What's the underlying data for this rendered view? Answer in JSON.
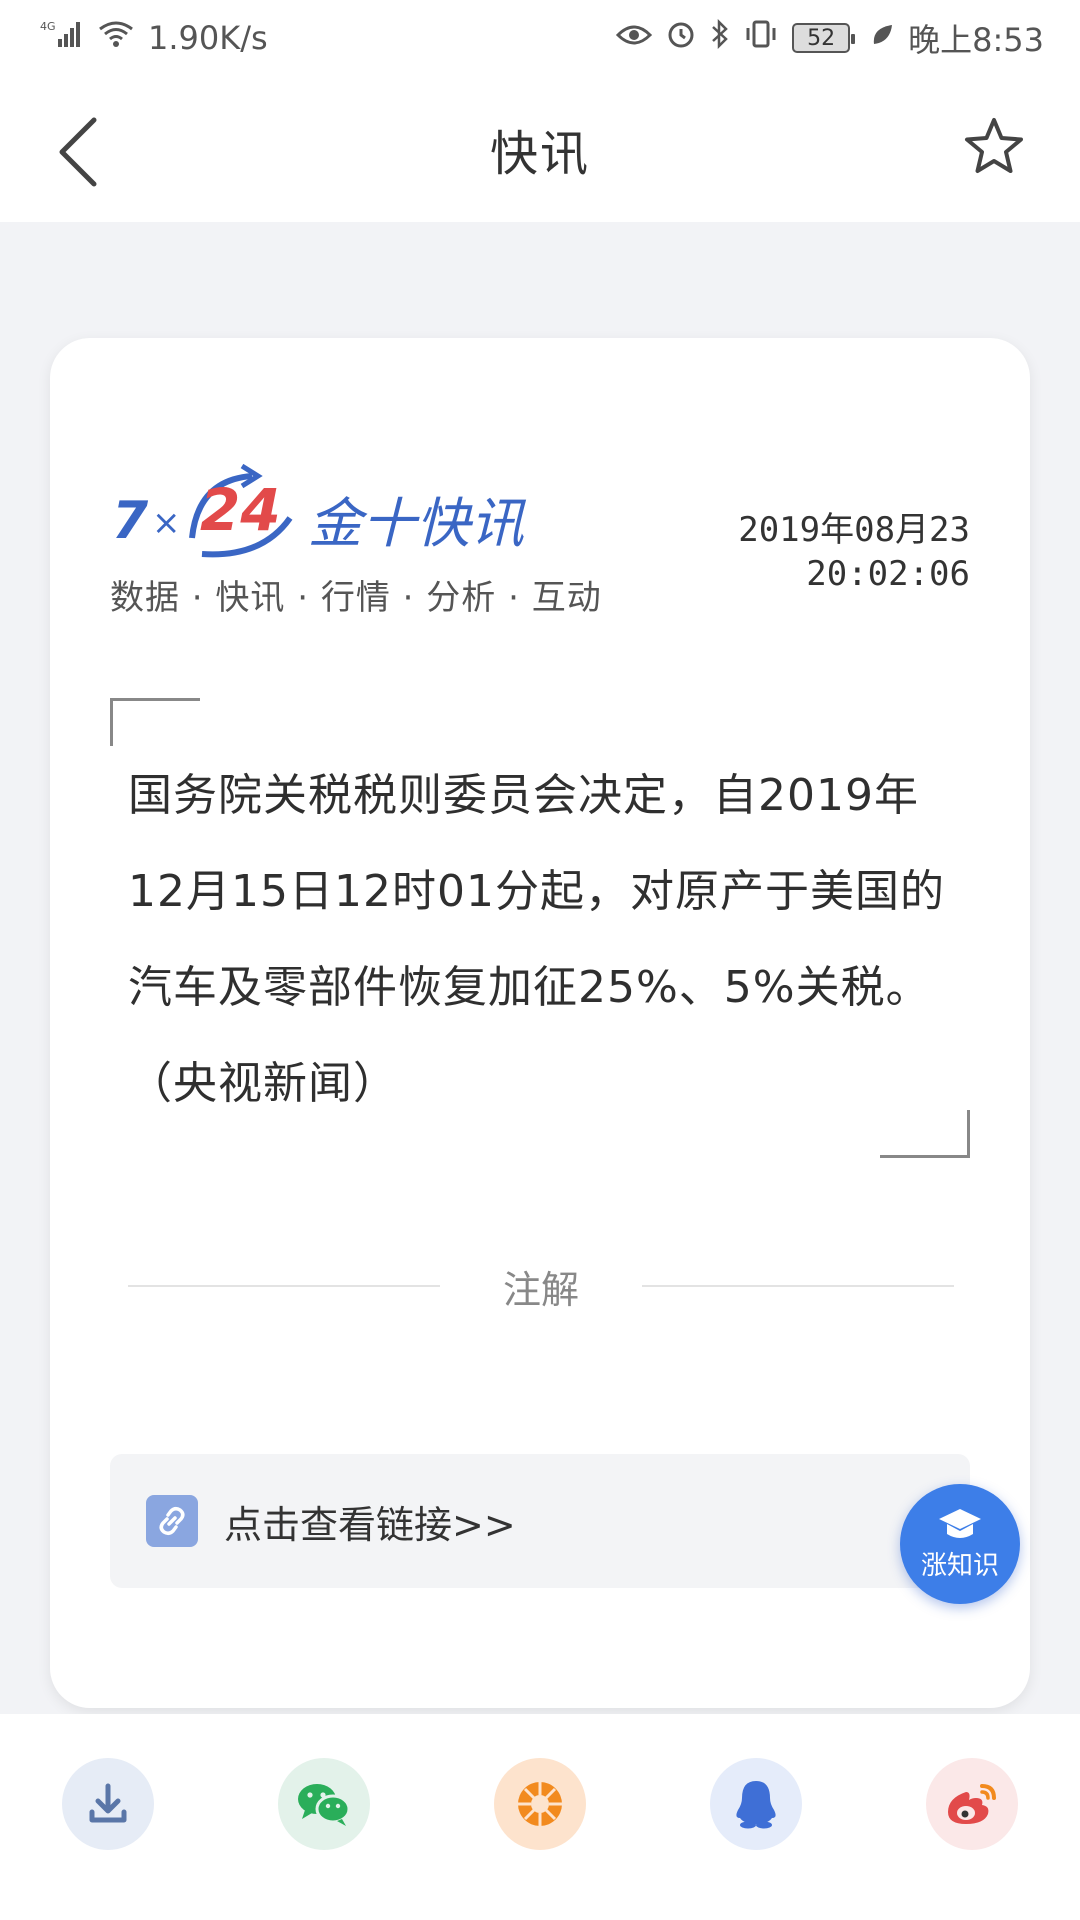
{
  "status_bar": {
    "network": "4G",
    "speed": "1.90K/s",
    "battery": "52",
    "time": "晚上8:53"
  },
  "nav": {
    "title": "快讯"
  },
  "card": {
    "logo": {
      "text": "7×24金十快讯",
      "tagline": "数据 · 快讯 · 行情 · 分析 · 互动"
    },
    "date": "2019年08月23",
    "time": "20:02:06",
    "content": "国务院关税税则委员会决定，自2019年12月15日12时01分起，对原产于美国的汽车及零部件恢复加征25%、5%关税。（央视新闻）",
    "annotation_label": "注解",
    "link_text": "点击查看链接>>"
  },
  "knowledge_button": {
    "label": "涨知识"
  },
  "share": [
    {
      "icon": "download-icon",
      "bg": "#e6ecf6",
      "color": "#5a76a8"
    },
    {
      "icon": "wechat-icon",
      "bg": "#e3f2ea",
      "color": "#2aae5a"
    },
    {
      "icon": "moments-icon",
      "bg": "#fde3cd",
      "color": "#f28a1e"
    },
    {
      "icon": "qq-icon",
      "bg": "#e5ecfa",
      "color": "#3f6fd6"
    },
    {
      "icon": "weibo-icon",
      "bg": "#fbe8e8",
      "color": "#e24a4a"
    }
  ],
  "colors": {
    "accent": "#3d7ee8",
    "logo_blue": "#3a66c4",
    "logo_red": "#e24a4a"
  }
}
